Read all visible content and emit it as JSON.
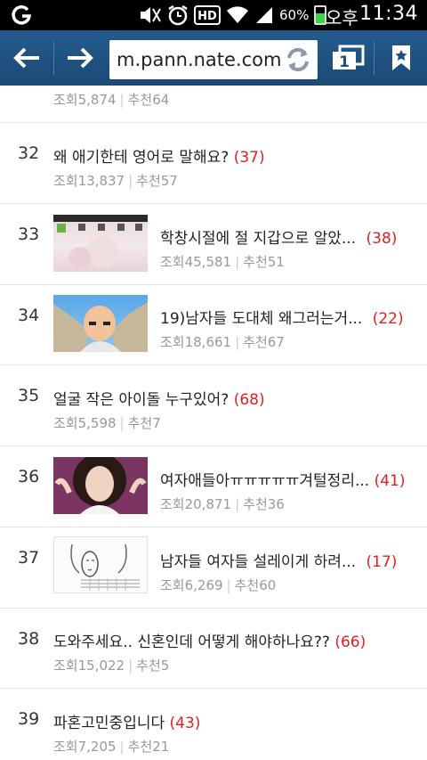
{
  "status_bar": {
    "battery": "60%",
    "ampm": "오후",
    "time": "11:34",
    "icons": [
      "g-icon",
      "mute-icon",
      "alarm-icon",
      "hd-icon",
      "wifi-icon",
      "signal-icon",
      "battery-icon"
    ]
  },
  "browser": {
    "url": "m.pann.nate.com",
    "tab_count": "1",
    "icons": [
      "back-arrow-icon",
      "forward-arrow-icon",
      "refresh-icon",
      "tabs-icon",
      "bookmark-icon"
    ]
  },
  "list": {
    "partial_top": {
      "views": "조회5,874",
      "recommends": "추천64"
    },
    "items": [
      {
        "rank": "32",
        "title": "왜 애기한테 영어로 말해요?",
        "comments": "(37)",
        "views": "조회13,837",
        "recommends": "추천57",
        "has_thumb": false
      },
      {
        "rank": "33",
        "title": "학창시절에 절 지갑으로 알았...",
        "comments": "(38)",
        "views": "조회45,581",
        "recommends": "추천51",
        "has_thumb": true,
        "thumb": "screenshot-thumbnail"
      },
      {
        "rank": "34",
        "title": "19)남자들 도대체 왜그러는거...",
        "comments": "(22)",
        "views": "조회18,661",
        "recommends": "추천67",
        "has_thumb": true,
        "thumb": "cartoon-thumbnail"
      },
      {
        "rank": "35",
        "title": "얼굴 작은 아이돌 누구있어?",
        "comments": "(68)",
        "views": "조회5,598",
        "recommends": "추천7",
        "has_thumb": false
      },
      {
        "rank": "36",
        "title": "여자애들아ㅠㅠㅠㅠㅠ겨털정리...",
        "comments": "(41)",
        "views": "조회20,871",
        "recommends": "추천36",
        "has_thumb": true,
        "thumb": "photo-thumbnail"
      },
      {
        "rank": "37",
        "title": "남자들 여자들 설레이게 하려...",
        "comments": "(17)",
        "views": "조회6,269",
        "recommends": "추천60",
        "has_thumb": true,
        "thumb": "drawing-thumbnail"
      },
      {
        "rank": "38",
        "title": "도와주세요.. 신혼인데 어떻게 해야하나요??",
        "comments": "(66)",
        "views": "조회15,022",
        "recommends": "추천5",
        "has_thumb": false
      },
      {
        "rank": "39",
        "title": "파혼고민중입니다",
        "comments": "(43)",
        "views": "조회7,205",
        "recommends": "추천21",
        "has_thumb": false
      }
    ]
  }
}
